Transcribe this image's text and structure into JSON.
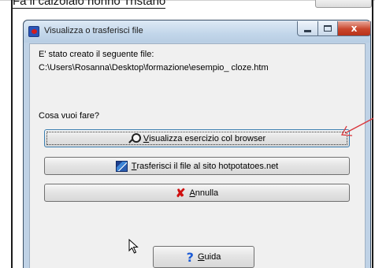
{
  "background_doc": {
    "heading": "Fa il calzolaio nonno Tristano"
  },
  "dialog": {
    "title": "Visualizza o trasferisci file",
    "close_glyph": "x",
    "created_label": "E' stato creato il seguente file:",
    "file_path": "C:\\Users\\Rosanna\\Desktop\\formazione\\esempio_ cloze.htm",
    "question": "Cosa vuoi fare?",
    "buttons": {
      "view": {
        "mnemonic": "V",
        "rest": "isualizza esercizio col browser",
        "icon": "magnifier-icon"
      },
      "transfer": {
        "mnemonic": "T",
        "rest": "rasferisci il file al sito hotpotatoes.net",
        "icon": "globe-icon"
      },
      "cancel": {
        "glyph": "✘",
        "mnemonic": "A",
        "rest": "nnulla",
        "icon": "x-icon",
        "icon_color": "#d01010"
      },
      "help": {
        "glyph": "?",
        "mnemonic": "G",
        "rest": "uida",
        "icon": "question-icon",
        "icon_color": "#1c5bd6"
      }
    }
  },
  "annotation": {
    "arrow_color": "#d9343a"
  }
}
